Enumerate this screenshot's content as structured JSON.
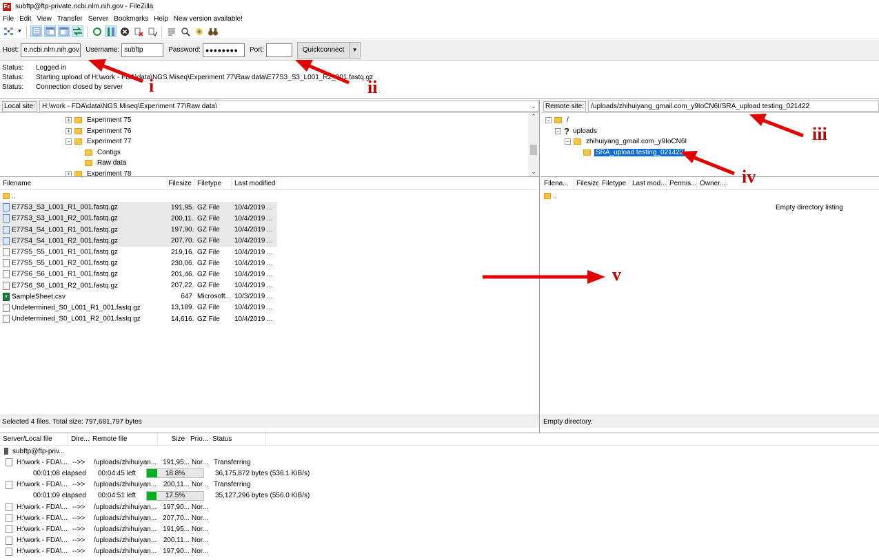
{
  "window": {
    "title": "subftp@ftp-private.ncbi.nlm.nih.gov - FileZilla",
    "app_icon": "Fz"
  },
  "menu": [
    "File",
    "Edit",
    "View",
    "Transfer",
    "Server",
    "Bookmarks",
    "Help",
    "New version available!"
  ],
  "toolbar": {
    "icons": [
      "site-manager-icon",
      "dropdown-icon",
      "toggle-log-icon",
      "toggle-local-tree-icon",
      "toggle-remote-tree-icon",
      "toggle-queue-icon",
      "refresh-icon",
      "process-queue-icon",
      "cancel-icon",
      "disconnect-icon",
      "reconnect-icon",
      "filter-icon",
      "compare-icon",
      "sync-browse-icon",
      "find-icon"
    ]
  },
  "quickconnect": {
    "host_label": "Host:",
    "host_value": "e.ncbi.nlm.nih.gov",
    "username_label": "Username:",
    "username_value": "subftp",
    "password_label": "Password:",
    "password_value": "●●●●●●●●",
    "port_label": "Port:",
    "port_value": "",
    "button_label": "Quickconnect",
    "dropdown_glyph": "▼"
  },
  "log": [
    {
      "key": "Status:",
      "text": "Logged in"
    },
    {
      "key": "Status:",
      "text": "Starting upload of H:\\work - FDA\\data\\NGS Miseq\\Experiment 77\\Raw data\\E77S3_S3_L001_R2_001.fastq.gz"
    },
    {
      "key": "Status:",
      "text": "Connection closed by server"
    }
  ],
  "local": {
    "site_label": "Local site:",
    "site_path": "H:\\work - FDA\\data\\NGS Miseq\\Experiment 77\\Raw data\\",
    "tree": [
      {
        "label": "Experiment 75",
        "expander": "+",
        "level": 0
      },
      {
        "label": "Experiment 76",
        "expander": "+",
        "level": 0
      },
      {
        "label": "Experiment 77",
        "expander": "−",
        "level": 0
      },
      {
        "label": "Contigs",
        "expander": "",
        "level": 1
      },
      {
        "label": "Raw data",
        "expander": "",
        "level": 1
      },
      {
        "label": "Experiment 78",
        "expander": "+",
        "level": 0
      }
    ],
    "columns": [
      "Filename",
      "Filesize",
      "Filetype",
      "Last modified"
    ],
    "files": [
      {
        "name": "..",
        "size": "",
        "type": "",
        "modified": "",
        "icon": "folder",
        "selected": false
      },
      {
        "name": "E77S3_S3_L001_R1_001.fastq.gz",
        "size": "191,95...",
        "type": "GZ File",
        "modified": "10/4/2019 ...",
        "icon": "gz",
        "selected": true
      },
      {
        "name": "E77S3_S3_L001_R2_001.fastq.gz",
        "size": "200,11...",
        "type": "GZ File",
        "modified": "10/4/2019 ...",
        "icon": "gz",
        "selected": true
      },
      {
        "name": "E77S4_S4_L001_R1_001.fastq.gz",
        "size": "197,90...",
        "type": "GZ File",
        "modified": "10/4/2019 ...",
        "icon": "gz",
        "selected": true
      },
      {
        "name": "E77S4_S4_L001_R2_001.fastq.gz",
        "size": "207,70...",
        "type": "GZ File",
        "modified": "10/4/2019 ...",
        "icon": "gz",
        "selected": true
      },
      {
        "name": "E77S5_S5_L001_R1_001.fastq.gz",
        "size": "219,16...",
        "type": "GZ File",
        "modified": "10/4/2019 ...",
        "icon": "file",
        "selected": false
      },
      {
        "name": "E77S5_S5_L001_R2_001.fastq.gz",
        "size": "230,06...",
        "type": "GZ File",
        "modified": "10/4/2019 ...",
        "icon": "file",
        "selected": false
      },
      {
        "name": "E77S6_S6_L001_R1_001.fastq.gz",
        "size": "201,46...",
        "type": "GZ File",
        "modified": "10/4/2019 ...",
        "icon": "file",
        "selected": false
      },
      {
        "name": "E77S6_S6_L001_R2_001.fastq.gz",
        "size": "207,22...",
        "type": "GZ File",
        "modified": "10/4/2019 ...",
        "icon": "file",
        "selected": false
      },
      {
        "name": "SampleSheet.csv",
        "size": "647",
        "type": "Microsoft...",
        "modified": "10/3/2019 ...",
        "icon": "csv",
        "selected": false
      },
      {
        "name": "Undetermined_S0_L001_R1_001.fastq.gz",
        "size": "13,189...",
        "type": "GZ File",
        "modified": "10/4/2019 ...",
        "icon": "file",
        "selected": false
      },
      {
        "name": "Undetermined_S0_L001_R2_001.fastq.gz",
        "size": "14,616...",
        "type": "GZ File",
        "modified": "10/4/2019 ...",
        "icon": "file",
        "selected": false
      }
    ],
    "status": "Selected 4 files. Total size: 797,681,797 bytes"
  },
  "remote": {
    "site_label": "Remote site:",
    "site_path": "/uploads/zhihuiyang_gmail.com_y9IoCN6I/SRA_upload testing_021422",
    "tree": [
      {
        "label": "/",
        "expander": "−",
        "level": 0,
        "icon": "folder"
      },
      {
        "label": "uploads",
        "expander": "−",
        "level": 1,
        "icon": "unknown"
      },
      {
        "label": "zhihuiyang_gmail.com_y9IoCN6I",
        "expander": "−",
        "level": 2,
        "icon": "folder"
      },
      {
        "label": "SRA_upload testing_021422",
        "expander": "",
        "level": 3,
        "icon": "folder",
        "selected": true
      }
    ],
    "columns": [
      "Filena...",
      "Filesize",
      "Filetype",
      "Last mod...",
      "Permis...",
      "Owner..."
    ],
    "files": [
      {
        "name": ".."
      }
    ],
    "empty_text": "Empty directory listing",
    "status": "Empty directory."
  },
  "queue": {
    "columns": [
      "Server/Local file",
      "Dire...",
      "Remote file",
      "Size",
      "Prio...",
      "Status"
    ],
    "server": "subftp@ftp-priv...",
    "rows": [
      {
        "local": "H:\\work - FDA\\...",
        "dir": "-->>",
        "remote": "/uploads/zhihuiyan...",
        "size": "191,95...",
        "prio": "Nor...",
        "status": "Transferring",
        "progress": {
          "elapsed": "00:01:08 elapsed",
          "left": "00:04:45 left",
          "percent_text": "18.8%",
          "fraction": 0.188,
          "bytes": "36,175,872 bytes (536.1 KiB/s)"
        }
      },
      {
        "local": "H:\\work - FDA\\...",
        "dir": "-->>",
        "remote": "/uploads/zhihuiyan...",
        "size": "200,11...",
        "prio": "Nor...",
        "status": "Transferring",
        "progress": {
          "elapsed": "00:01:09 elapsed",
          "left": "00:04:51 left",
          "percent_text": "17.5%",
          "fraction": 0.175,
          "bytes": "35,127,296 bytes (556.0 KiB/s)"
        }
      },
      {
        "local": "H:\\work - FDA\\...",
        "dir": "-->>",
        "remote": "/uploads/zhihuiyan...",
        "size": "197,90...",
        "prio": "Nor...",
        "status": ""
      },
      {
        "local": "H:\\work - FDA\\...",
        "dir": "-->>",
        "remote": "/uploads/zhihuiyan...",
        "size": "207,70...",
        "prio": "Nor...",
        "status": ""
      },
      {
        "local": "H:\\work - FDA\\...",
        "dir": "-->>",
        "remote": "/uploads/zhihuiyan...",
        "size": "191,95...",
        "prio": "Nor...",
        "status": ""
      },
      {
        "local": "H:\\work - FDA\\...",
        "dir": "-->>",
        "remote": "/uploads/zhihuiyan...",
        "size": "200,11...",
        "prio": "Nor...",
        "status": ""
      },
      {
        "local": "H:\\work - FDA\\...",
        "dir": "-->>",
        "remote": "/uploads/zhihuiyan...",
        "size": "197,90...",
        "prio": "Nor...",
        "status": ""
      }
    ]
  },
  "annotations": {
    "labels": [
      "i",
      "ii",
      "iii",
      "iv",
      "v"
    ],
    "color": "#e00000"
  }
}
